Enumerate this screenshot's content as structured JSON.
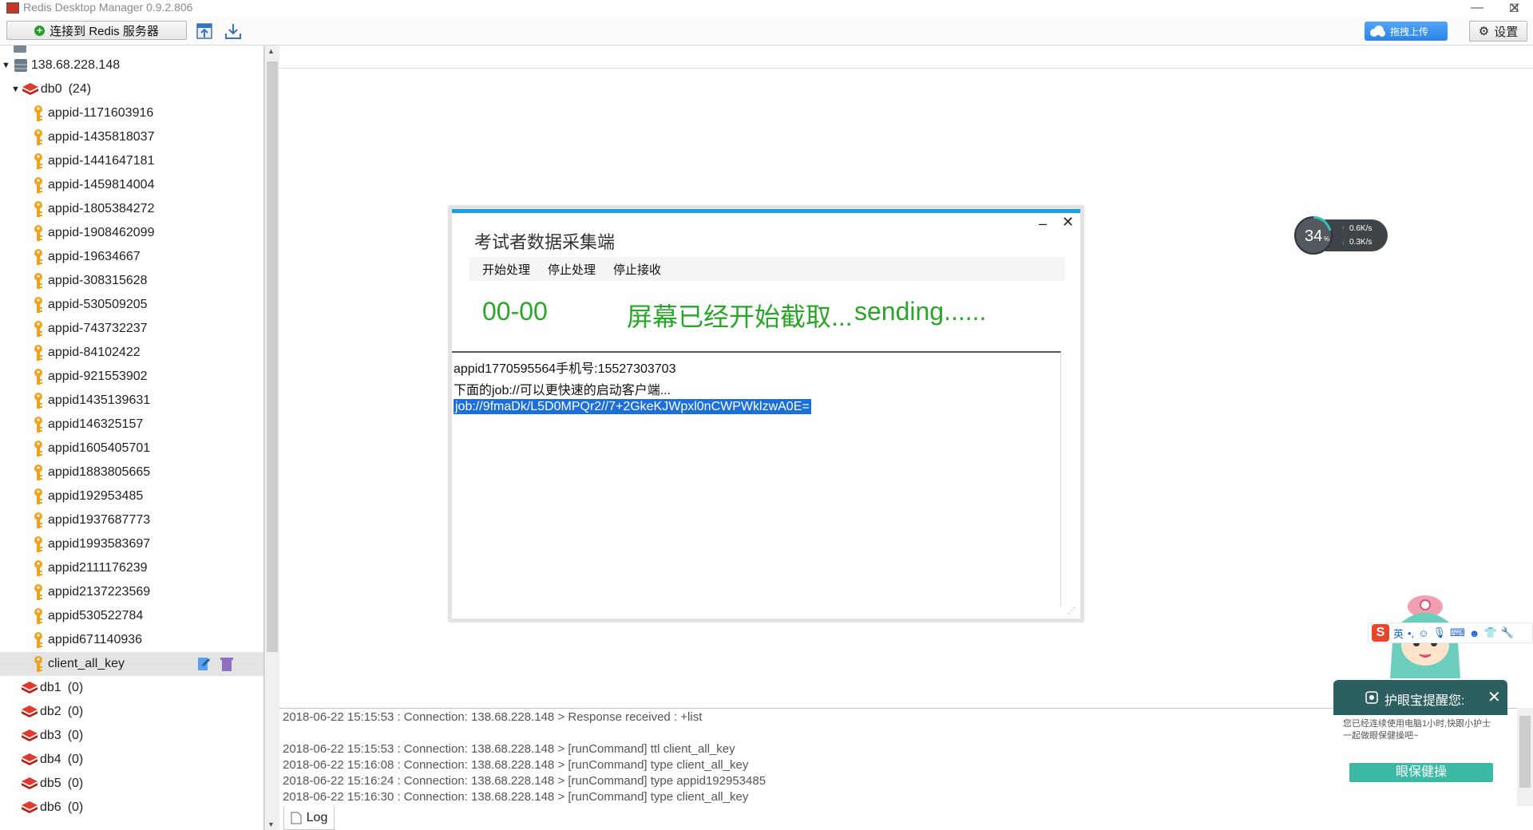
{
  "window": {
    "title": "Redis Desktop Manager 0.9.2.806"
  },
  "toolbar": {
    "connect_label": "连接到 Redis 服务器",
    "upload_label": "拖拽上传",
    "settings_label": "设置"
  },
  "tree": {
    "server": "138.68.228.148",
    "db0": {
      "name": "db0",
      "count": "(24)"
    },
    "keys": [
      "appid-1171603916",
      "appid-1435818037",
      "appid-1441647181",
      "appid-1459814004",
      "appid-1805384272",
      "appid-1908462099",
      "appid-19634667",
      "appid-308315628",
      "appid-530509205",
      "appid-743732237",
      "appid-84102422",
      "appid-921553902",
      "appid1435139631",
      "appid146325157",
      "appid1605405701",
      "appid1883805665",
      "appid192953485",
      "appid1937687773",
      "appid1993583697",
      "appid2111176239",
      "appid2137223569",
      "appid530522784",
      "appid671140936",
      "client_all_key"
    ],
    "dbs": [
      {
        "name": "db1",
        "count": "(0)"
      },
      {
        "name": "db2",
        "count": "(0)"
      },
      {
        "name": "db3",
        "count": "(0)"
      },
      {
        "name": "db4",
        "count": "(0)"
      },
      {
        "name": "db5",
        "count": "(0)"
      },
      {
        "name": "db6",
        "count": "(0)"
      }
    ]
  },
  "log": {
    "lines": [
      "2018-06-22 15:15:53 : Connection: 138.68.228.148 > Response received : +list",
      "",
      "2018-06-22 15:15:53 : Connection: 138.68.228.148 > [runCommand] ttl client_all_key",
      "2018-06-22 15:16:08 : Connection: 138.68.228.148 > [runCommand] type client_all_key",
      "2018-06-22 15:16:24 : Connection: 138.68.228.148 > [runCommand] type appid192953485",
      "2018-06-22 15:16:30 : Connection: 138.68.228.148 > [runCommand] type client_all_key"
    ],
    "tab_label": "Log"
  },
  "dialog": {
    "title": "考试者数据采集端",
    "menu": [
      "开始处理",
      "停止处理",
      "停止接收"
    ],
    "status_code": "00-00",
    "status_text": "屏幕已经开始截取...",
    "sending_text": "sending......",
    "lines": [
      "appid1770595564手机号:15527303703",
      "下面的job://可以更快速的启动客户端...",
      "job://9fmaDk/L5D0MPQr2//7+2GkeKJWpxl0nCWPWklzwA0E="
    ]
  },
  "speed": {
    "percent": "34",
    "unit": "%",
    "up": "0.6K/s",
    "down": "0.3K/s"
  },
  "ime": {
    "lang": "英"
  },
  "reminder": {
    "title": "护眼宝提醒您:",
    "body": "您已经连续使用电脑1小时,快跟小护士一起做眼保健操吧~",
    "button": "眼保健操"
  },
  "colors": {
    "accent": "#1ea1e0",
    "status_green": "#2aa52a",
    "selection": "#1c6fd6",
    "key_icon": "#f3a11b",
    "db_icon": "#d62a2a"
  }
}
